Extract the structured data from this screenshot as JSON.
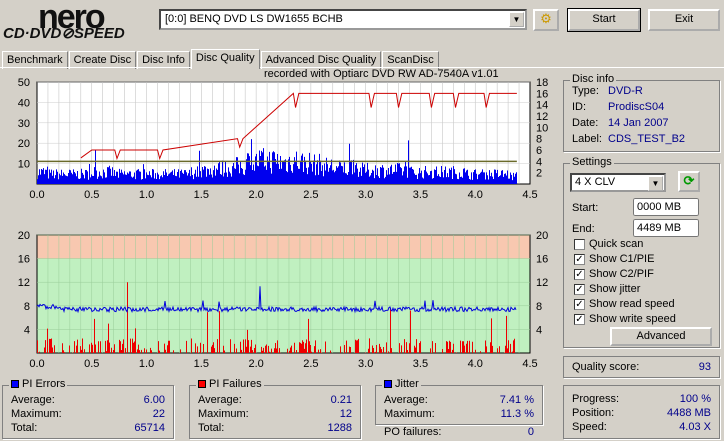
{
  "app": {
    "logo_top": "nero",
    "logo_bottom": "CD·DVD⊘SPEED",
    "drive": "[0:0]  BENQ DVD LS DW1655 BCHB",
    "start": "Start",
    "exit": "Exit"
  },
  "tabs": [
    "Benchmark",
    "Create Disc",
    "Disc Info",
    "Disc Quality",
    "Advanced Disc Quality",
    "ScanDisc"
  ],
  "active_tab": "Disc Quality",
  "recorded_with": "recorded with Optiarc DVD RW AD-7540A  v1.01",
  "disc_info": {
    "title": "Disc info",
    "type_label": "Type:",
    "type": "DVD-R",
    "id_label": "ID:",
    "id": "ProdiscS04",
    "date_label": "Date:",
    "date": "14 Jan 2007",
    "label_label": "Label:",
    "label": "CDS_TEST_B2"
  },
  "settings": {
    "title": "Settings",
    "speed": "4 X CLV",
    "start_label": "Start:",
    "start": "0000 MB",
    "end_label": "End:",
    "end": "4489 MB",
    "options": [
      {
        "label": "Quick scan",
        "checked": false
      },
      {
        "label": "Show C1/PIE",
        "checked": true
      },
      {
        "label": "Show C2/PIF",
        "checked": true
      },
      {
        "label": "Show jitter",
        "checked": true
      },
      {
        "label": "Show read speed",
        "checked": true
      },
      {
        "label": "Show write speed",
        "checked": true
      }
    ],
    "advanced": "Advanced"
  },
  "quality": {
    "label": "Quality score:",
    "value": "93"
  },
  "pi_errors": {
    "title": "PI Errors",
    "color": "#0000ff",
    "average_label": "Average:",
    "average": "6.00",
    "maximum_label": "Maximum:",
    "maximum": "22",
    "total_label": "Total:",
    "total": "65714"
  },
  "pi_failures": {
    "title": "PI Failures",
    "color": "#ff0000",
    "average_label": "Average:",
    "average": "0.21",
    "maximum_label": "Maximum:",
    "maximum": "12",
    "total_label": "Total:",
    "total": "1288"
  },
  "jitter": {
    "title": "Jitter",
    "color": "#0000ff",
    "average_label": "Average:",
    "average": "7.41 %",
    "maximum_label": "Maximum:",
    "maximum": "11.3 %",
    "po_label": "PO failures:",
    "po": "0"
  },
  "progress": {
    "progress_label": "Progress:",
    "progress": "100 %",
    "position_label": "Position:",
    "position": "4488 MB",
    "speed_label": "Speed:",
    "speed": "4.03 X"
  },
  "chart_data": [
    {
      "type": "bar",
      "title": "PI Errors",
      "xlim": [
        0,
        4.5
      ],
      "ylim": [
        0,
        50
      ],
      "y2lim": [
        0,
        18
      ],
      "x_ticks": [
        "0.0",
        "0.5",
        "1.0",
        "1.5",
        "2.0",
        "2.5",
        "3.0",
        "3.5",
        "4.0",
        "4.5"
      ],
      "y_ticks": [
        "10",
        "20",
        "30",
        "40",
        "50"
      ],
      "y2_ticks": [
        "2",
        "4",
        "6",
        "8",
        "10",
        "12",
        "14",
        "16",
        "18"
      ],
      "pie_profile": [
        6,
        5,
        5,
        5,
        5,
        6,
        6,
        5,
        5,
        5,
        5,
        5,
        5,
        5,
        6,
        7,
        8,
        8,
        9,
        11,
        12,
        12,
        11,
        12,
        11,
        10,
        9,
        8,
        8,
        7,
        7,
        7,
        7,
        7,
        6,
        6,
        6,
        6,
        6,
        5,
        5,
        5,
        5,
        4
      ],
      "read_speed": {
        "x": [
          0,
          0.5,
          1.0,
          1.5,
          2.0,
          2.5,
          3.0,
          3.5,
          4.0,
          4.38
        ],
        "y": [
          4,
          4,
          4,
          4,
          4,
          4,
          4,
          4,
          4,
          4
        ]
      },
      "write_speed_max": 16,
      "write_speed_dips_at": [
        0.73,
        1.12,
        1.85,
        2.36,
        3.05,
        3.3,
        3.6,
        3.82,
        4.1
      ]
    },
    {
      "type": "bar",
      "title": "PI Failures / Jitter",
      "xlim": [
        0,
        4.5
      ],
      "ylim": [
        0,
        20
      ],
      "y_ticks": [
        "4",
        "8",
        "12",
        "16",
        "20"
      ],
      "x_ticks": [
        "0.0",
        "0.5",
        "1.0",
        "1.5",
        "2.0",
        "2.5",
        "3.0",
        "3.5",
        "4.0",
        "4.5"
      ],
      "jitter_avg": 7.41,
      "jitter_max": 11.3,
      "pif_max": 12
    }
  ]
}
